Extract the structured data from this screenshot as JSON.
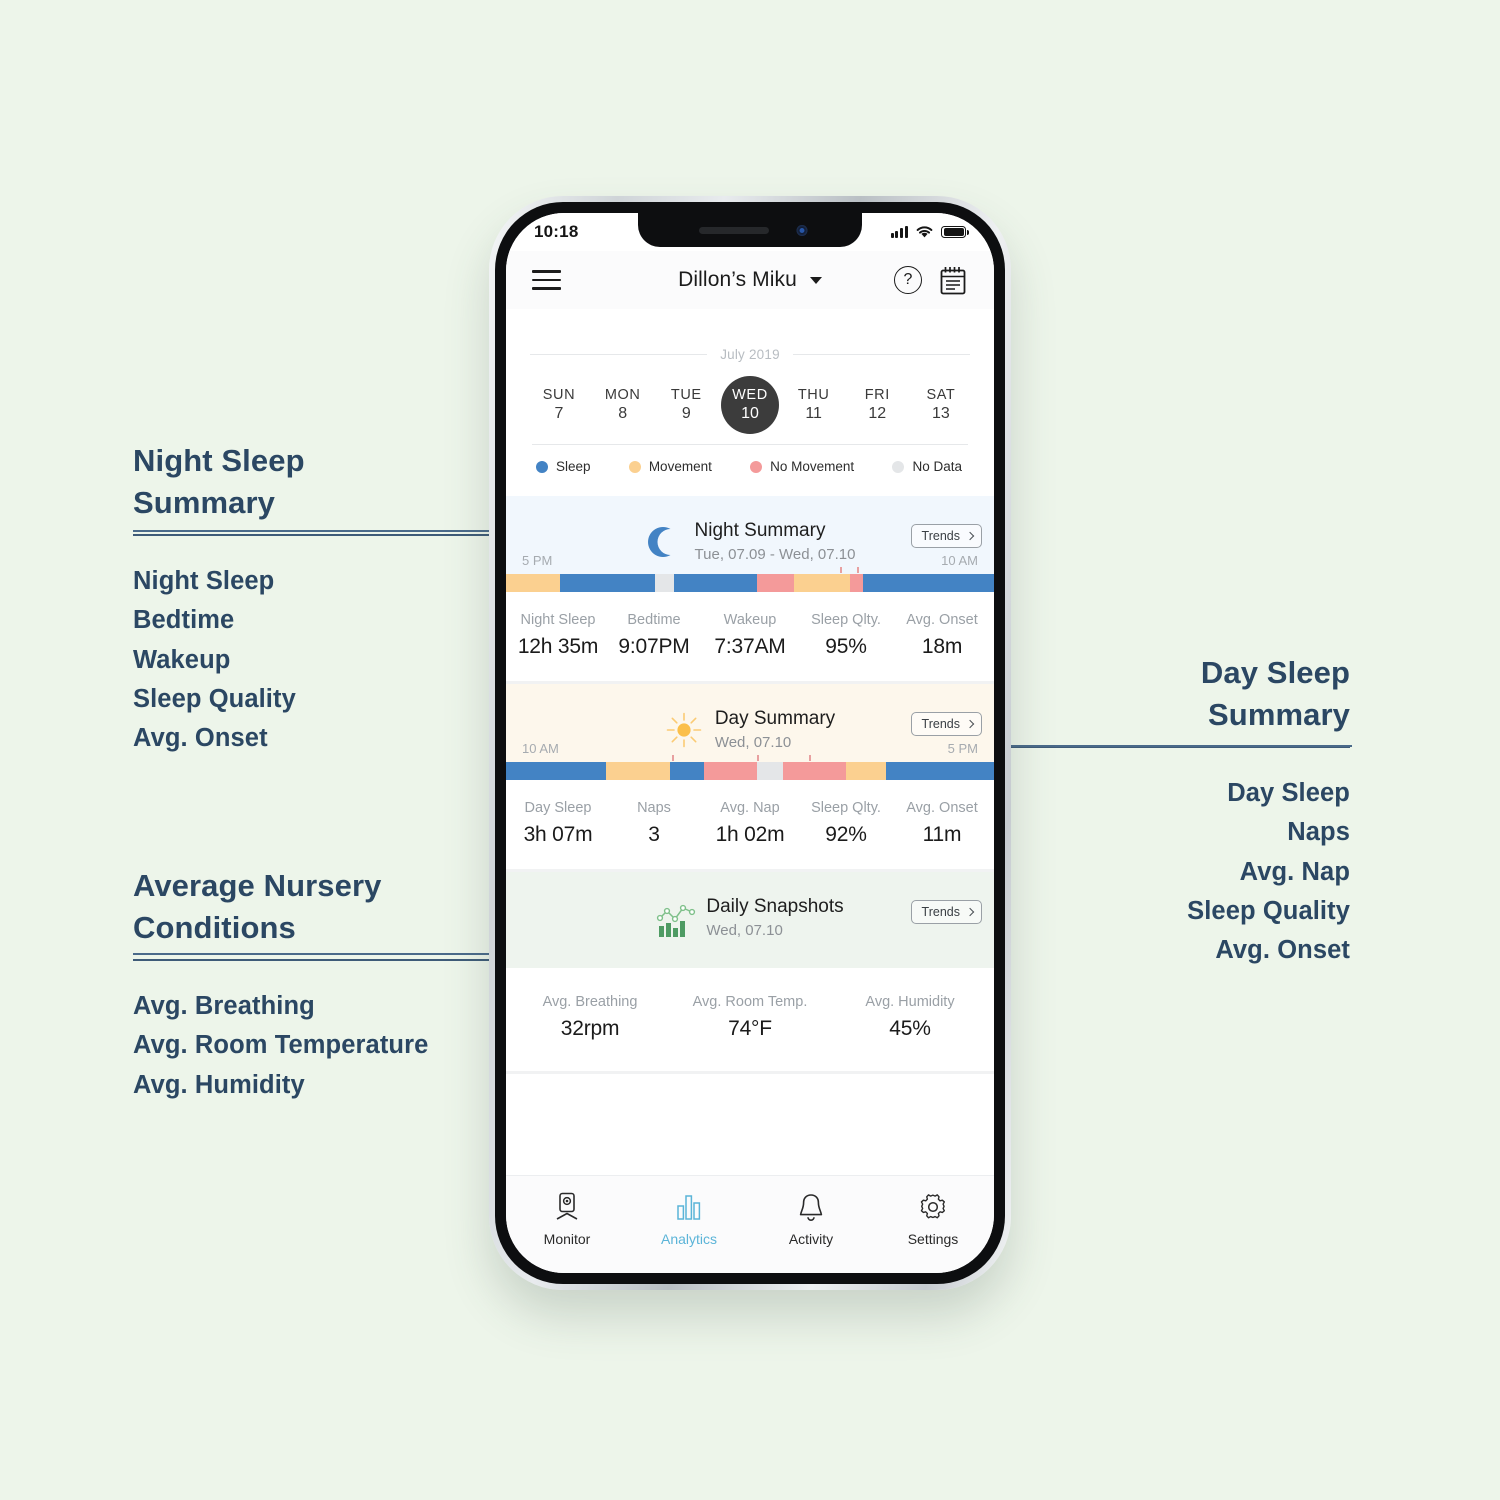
{
  "colors": {
    "page_bg": "#edf5ea",
    "annotation_text": "#2b4763",
    "sleep": "#4383c4",
    "movement": "#fbd090",
    "no_movement": "#f49a9a",
    "no_data": "#e4e6e8",
    "accent_active_tab": "#5bb4d8",
    "night_card_bg": "#f1f7fd",
    "day_card_bg": "#fdf7ec",
    "snapshot_card_bg": "#eef4ee"
  },
  "annotations": {
    "night": {
      "title": "Night Sleep\nSummary",
      "title_line1": "Night Sleep",
      "title_line2": "Summary",
      "items": [
        "Night Sleep",
        "Bedtime",
        "Wakeup",
        "Sleep Quality",
        "Avg. Onset"
      ]
    },
    "day": {
      "title_line1": "Day Sleep",
      "title_line2": "Summary",
      "items": [
        "Day Sleep",
        "Naps",
        "Avg. Nap",
        "Sleep Quality",
        "Avg. Onset"
      ]
    },
    "nursery": {
      "title_line1": "Average Nursery",
      "title_line2": "Conditions",
      "items": [
        "Avg. Breathing",
        "Avg. Room Temperature",
        "Avg. Humidity"
      ]
    }
  },
  "phone": {
    "status_bar": {
      "clock": "10:18",
      "signal_icon": "cellular-bars-icon",
      "wifi_icon": "wifi-icon",
      "battery_icon": "battery-full-icon"
    },
    "nav_bar": {
      "menu_icon": "hamburger-menu-icon",
      "title": "Dillon’s Miku",
      "caret_icon": "chevron-down-icon",
      "help_label": "?",
      "help_icon": "help-circle-icon",
      "journal_icon": "notepad-icon"
    },
    "calendar": {
      "month": "July 2019",
      "days": [
        {
          "dow": "SUN",
          "num": "7",
          "selected": false
        },
        {
          "dow": "MON",
          "num": "8",
          "selected": false
        },
        {
          "dow": "TUE",
          "num": "9",
          "selected": false
        },
        {
          "dow": "WED",
          "num": "10",
          "selected": true
        },
        {
          "dow": "THU",
          "num": "11",
          "selected": false
        },
        {
          "dow": "FRI",
          "num": "12",
          "selected": false
        },
        {
          "dow": "SAT",
          "num": "13",
          "selected": false
        }
      ]
    },
    "legend": [
      {
        "label": "Sleep",
        "color": "#4383c4"
      },
      {
        "label": "Movement",
        "color": "#fbd090"
      },
      {
        "label": "No Movement",
        "color": "#f49a9a"
      },
      {
        "label": "No Data",
        "color": "#e4e6e8"
      }
    ],
    "cards": [
      {
        "id": "night",
        "icon": "crescent-moon-icon",
        "title": "Night Summary",
        "subtitle": "Tue, 07.09 - Wed,  07.10",
        "trends_label": "Trends",
        "axis_start": "5 PM",
        "axis_end": "10 AM",
        "stats": [
          {
            "label": "Night Sleep",
            "value": "12h 35m"
          },
          {
            "label": "Bedtime",
            "value": "9:07PM"
          },
          {
            "label": "Wakeup",
            "value": "7:37AM"
          },
          {
            "label": "Sleep Qlty.",
            "value": "95%"
          },
          {
            "label": "Avg. Onset",
            "value": "18m"
          }
        ]
      },
      {
        "id": "day",
        "icon": "sun-icon",
        "title": "Day Summary",
        "subtitle": "Wed, 07.10",
        "trends_label": "Trends",
        "axis_start": "10 AM",
        "axis_end": "5 PM",
        "stats": [
          {
            "label": "Day Sleep",
            "value": "3h 07m"
          },
          {
            "label": "Naps",
            "value": "3"
          },
          {
            "label": "Avg. Nap",
            "value": "1h 02m"
          },
          {
            "label": "Sleep Qlty.",
            "value": "92%"
          },
          {
            "label": "Avg. Onset",
            "value": "11m"
          }
        ]
      },
      {
        "id": "snapshots",
        "icon": "chart-bars-line-icon",
        "title": "Daily Snapshots",
        "subtitle": "Wed, 07.10",
        "trends_label": "Trends",
        "stats": [
          {
            "label": "Avg. Breathing",
            "value": "32rpm"
          },
          {
            "label": "Avg. Room Temp.",
            "value": "74°F"
          },
          {
            "label": "Avg. Humidity",
            "value": "45%"
          }
        ]
      }
    ],
    "tab_bar": [
      {
        "label": "Monitor",
        "icon": "camera-monitor-icon",
        "active": false
      },
      {
        "label": "Analytics",
        "icon": "bar-chart-icon",
        "active": true
      },
      {
        "label": "Activity",
        "icon": "bell-icon",
        "active": false
      },
      {
        "label": "Settings",
        "icon": "gear-icon",
        "active": false
      }
    ]
  },
  "chart_data": [
    {
      "type": "timeline",
      "title": "Night Summary sleep timeline",
      "xlabel": "",
      "x_range": [
        "5 PM",
        "10 AM"
      ],
      "legend": [
        "Sleep",
        "Movement",
        "No Movement",
        "No Data"
      ],
      "segments": [
        {
          "state": "Movement",
          "color": "#fbd090",
          "pct": 11.0
        },
        {
          "state": "Sleep",
          "color": "#4383c4",
          "pct": 19.5
        },
        {
          "state": "No Data",
          "color": "#e4e6e8",
          "pct": 3.9
        },
        {
          "state": "Sleep",
          "color": "#4383c4",
          "pct": 17.1
        },
        {
          "state": "No Movement",
          "color": "#f49a9a",
          "pct": 7.6
        },
        {
          "state": "Movement",
          "color": "#fbd090",
          "pct": 11.5
        },
        {
          "state": "No Movement",
          "color": "#f49a9a",
          "pct": 2.5
        },
        {
          "state": "Sleep",
          "color": "#4383c4",
          "pct": 26.9
        }
      ],
      "ticks_pct": [
        68.5,
        72.0
      ]
    },
    {
      "type": "timeline",
      "title": "Day Summary sleep timeline",
      "xlabel": "",
      "x_range": [
        "10 AM",
        "5 PM"
      ],
      "legend": [
        "Sleep",
        "Movement",
        "No Movement",
        "No Data"
      ],
      "segments": [
        {
          "state": "Sleep",
          "color": "#4383c4",
          "pct": 20.4
        },
        {
          "state": "Movement",
          "color": "#fbd090",
          "pct": 13.2
        },
        {
          "state": "Sleep",
          "color": "#4383c4",
          "pct": 7.0
        },
        {
          "state": "No Movement",
          "color": "#f49a9a",
          "pct": 10.9
        },
        {
          "state": "No Data",
          "color": "#e4e6e8",
          "pct": 5.2
        },
        {
          "state": "No Movement",
          "color": "#f49a9a",
          "pct": 13.0
        },
        {
          "state": "Movement",
          "color": "#fbd090",
          "pct": 8.2
        },
        {
          "state": "Sleep",
          "color": "#4383c4",
          "pct": 22.1
        }
      ],
      "ticks_pct": [
        34.0,
        51.5,
        62.0
      ]
    }
  ]
}
